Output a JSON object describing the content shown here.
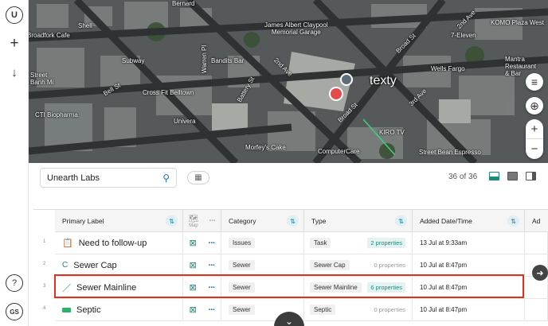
{
  "rail": {
    "logo": "U",
    "help": "?",
    "avatar": "GS"
  },
  "map": {
    "labels": {
      "shell": "Shell",
      "bernard": "Bernard",
      "broadfork": "Broadfork Cafe",
      "james": "James Albert Claypool\nMemorial Garage",
      "eleven": "7-Eleven",
      "komo": "KOMO Plaza West",
      "subway": "Subway",
      "bandits": "Bandits Bar",
      "crossfit": "Cross Fit Belltown",
      "univera": "Univera",
      "street": "Street\nBanh Mi",
      "cti": "CTI Biopharma",
      "wells": "Wells Fargo",
      "mantra": "Mantra\nRestaurant\n& Bar",
      "texty": "texty",
      "morfeys": "Morfey's Cake",
      "kiro": "KIRO TV",
      "computercare": "ComputerCare",
      "streetbean": "Street Bean Espresso",
      "warren": "Warren Pl",
      "broad1": "Broad St",
      "broad2": "Broad St",
      "ave2": "2nd Ave",
      "ave3": "3rd Ave",
      "ave2b": "2nd Ave",
      "bellst": "Bell St",
      "battery": "Battery St"
    }
  },
  "panel": {
    "search_value": "Unearth Labs",
    "count": "36 of 36"
  },
  "table": {
    "headers": {
      "primary": "Primary Label",
      "map": "Map",
      "category": "Category",
      "type": "Type",
      "date": "Added Date/Time",
      "ad": "Ad"
    },
    "rows": [
      {
        "num": "1",
        "label": "Need to follow-up",
        "category": "Issues",
        "type": "Task",
        "props": "2 properties",
        "date": "13 Jul at 9:33am"
      },
      {
        "num": "2",
        "label": "Sewer Cap",
        "category": "Sewer",
        "type": "Sewer Cap",
        "props": "0 properties",
        "date": "10 Jul at 8:47pm"
      },
      {
        "num": "3",
        "label": "Sewer Mainline",
        "category": "Sewer",
        "type": "Sewer Mainline",
        "props": "6 properties",
        "date": "10 Jul at 8:47pm"
      },
      {
        "num": "4",
        "label": "Septic",
        "category": "Sewer",
        "type": "Septic",
        "props": "0 properties",
        "date": "10 Jul at 8:47pm"
      }
    ]
  },
  "colors": {
    "accent": "#1e8a7d",
    "highlight": "#e0301e"
  }
}
